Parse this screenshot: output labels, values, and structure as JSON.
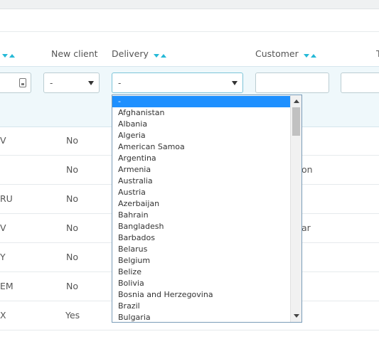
{
  "table": {
    "headers": {
      "new_client": "New client",
      "delivery": "Delivery",
      "customer": "Customer",
      "trailing": "T"
    },
    "filters": {
      "new_client_value": "-",
      "delivery_value": "-"
    },
    "rows": [
      {
        "code": "V",
        "new_client": "No",
        "customer": ""
      },
      {
        "code": "",
        "new_client": "No",
        "customer": "on"
      },
      {
        "code": "RU",
        "new_client": "No",
        "customer": ""
      },
      {
        "code": "V",
        "new_client": "No",
        "customer": "ar"
      },
      {
        "code": "Y",
        "new_client": "No",
        "customer": ""
      },
      {
        "code": "EM",
        "new_client": "No",
        "customer": ""
      },
      {
        "code": "X",
        "new_client": "Yes",
        "customer": ""
      }
    ]
  },
  "delivery_dropdown": {
    "options": [
      "-",
      "Afghanistan",
      "Albania",
      "Algeria",
      "American Samoa",
      "Argentina",
      "Armenia",
      "Australia",
      "Austria",
      "Azerbaijan",
      "Bahrain",
      "Bangladesh",
      "Barbados",
      "Belarus",
      "Belgium",
      "Belize",
      "Bolivia",
      "Bosnia and Herzegovina",
      "Brazil",
      "Bulgaria"
    ],
    "selected_index": 0
  },
  "colors": {
    "accent": "#25b9d7",
    "selected_option": "#1e90ff",
    "filter_background": "#eff8fb"
  },
  "icons": {
    "sort_desc": "triangle-down",
    "sort_asc": "triangle-up",
    "date_filter": "calendar-icon",
    "select_caret": "chevron-down-icon"
  }
}
